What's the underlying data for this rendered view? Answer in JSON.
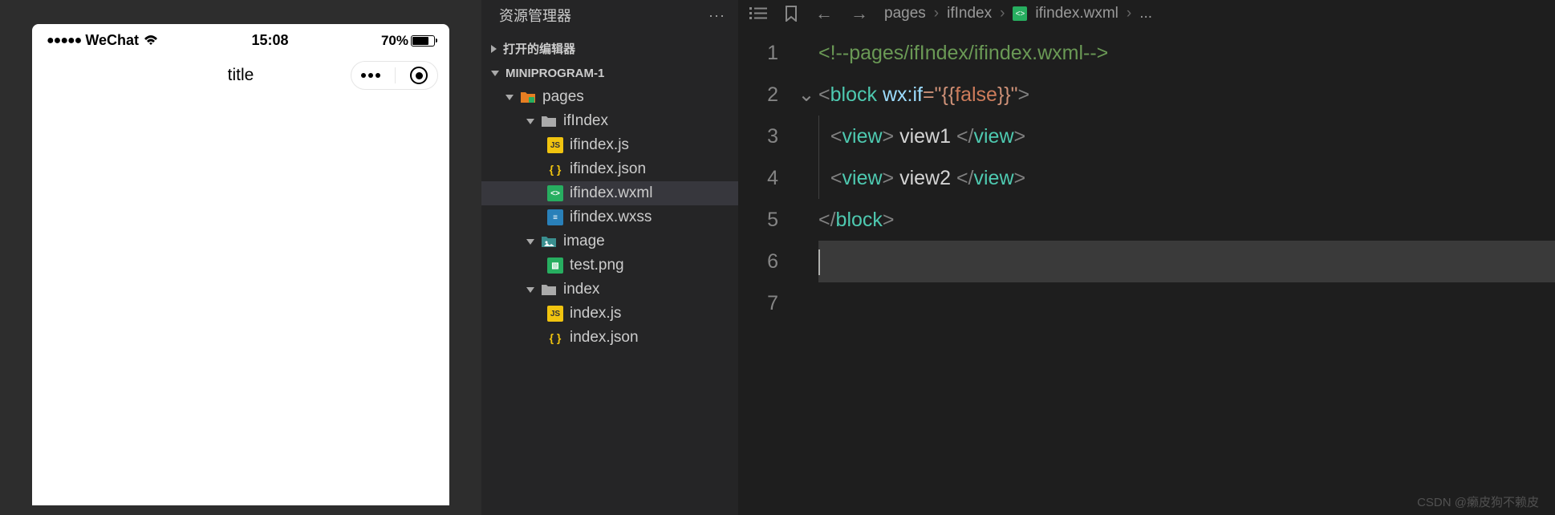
{
  "simulator": {
    "carrier": "WeChat",
    "time": "15:08",
    "battery_pct": "70%",
    "nav_title": "title"
  },
  "explorer": {
    "title": "资源管理器",
    "sections": {
      "open_editors": "打开的编辑器",
      "project": "MINIPROGRAM-1"
    },
    "tree": {
      "pages": "pages",
      "ifIndex": "ifIndex",
      "ifindex_js": "ifindex.js",
      "ifindex_json": "ifindex.json",
      "ifindex_wxml": "ifindex.wxml",
      "ifindex_wxss": "ifindex.wxss",
      "image": "image",
      "test_png": "test.png",
      "index": "index",
      "index_js": "index.js",
      "index_json": "index.json"
    }
  },
  "editor": {
    "breadcrumb": {
      "p1": "pages",
      "p2": "ifIndex",
      "p3": "ifindex.wxml",
      "p4": "..."
    },
    "lines": [
      "1",
      "2",
      "3",
      "4",
      "5",
      "6",
      "7"
    ],
    "code": {
      "comment": "<!--pages/ifIndex/ifindex.wxml-->",
      "block_open_tag": "block",
      "wx_if_attr": "wx:if",
      "wx_if_val_open": "=\"{{",
      "wx_if_false": "false",
      "wx_if_val_close": "}}\"",
      "view_tag": "view",
      "view1_text": " view1 ",
      "view2_text": " view2 ",
      "block_close": "block"
    }
  },
  "watermark": "CSDN @癞皮狗不赖皮"
}
